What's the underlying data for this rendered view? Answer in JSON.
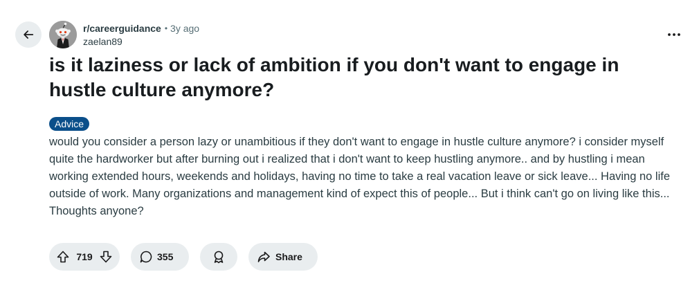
{
  "post": {
    "subreddit": "r/careerguidance",
    "separator": "•",
    "time": "3y ago",
    "author": "zaelan89",
    "title": "is it laziness or lack of ambition if you don't want to engage in hustle culture anymore?",
    "flair": "Advice",
    "body": "would you consider a person lazy or unambitious if they don't want to engage in hustle culture anymore? i consider myself quite the hardworker but after burning out i realized that i don't want to keep hustling anymore.. and by hustling i mean working extended hours, weekends and holidays, having no time to take a real vacation leave or sick leave... Having no life outside of work. Many organizations and management kind of expect this of people... But i think can't go on living like this... Thoughts anyone?"
  },
  "actions": {
    "votes": "719",
    "comments": "355",
    "share_label": "Share"
  },
  "icons": {
    "back": "arrow-left-icon",
    "more": "more-horizontal-icon",
    "upvote": "arrow-up-icon",
    "downvote": "arrow-down-icon",
    "comment": "comment-bubble-icon",
    "award": "award-icon",
    "share": "share-arrow-icon"
  },
  "colors": {
    "flair_bg": "#0b4f8a",
    "pill_bg": "#e9edef",
    "text_secondary": "#576f76"
  }
}
